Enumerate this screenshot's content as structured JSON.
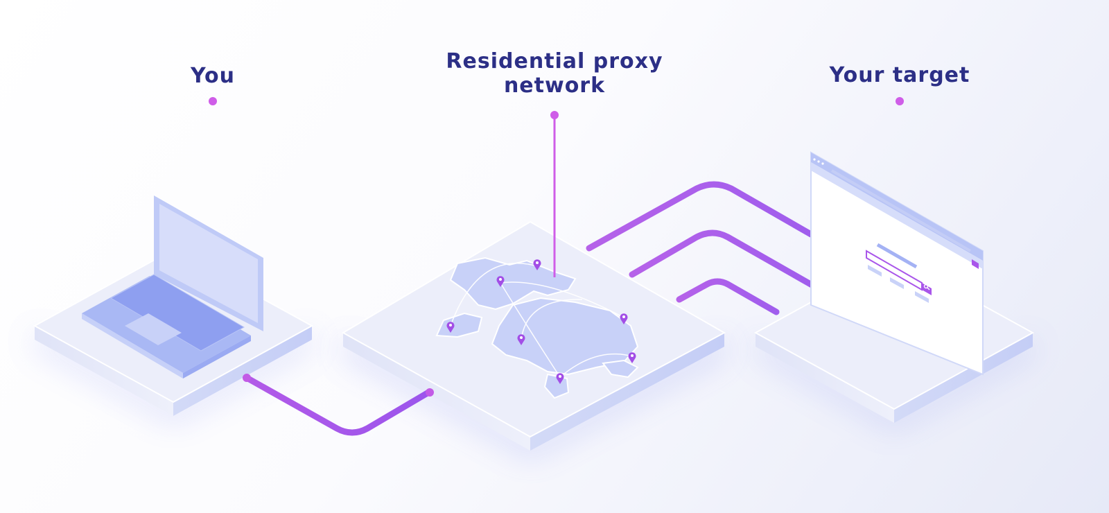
{
  "labels": {
    "you": "You",
    "network_line1": "Residential proxy",
    "network_line2": "network",
    "target": "Your target"
  },
  "colors": {
    "label_text": "#2c2f86",
    "connector": "#a956ea",
    "accent_pin": "#cf5de8",
    "platform": "#e9ebf8",
    "device_blue": "#b8c4f6",
    "keys": "#93a4f2"
  },
  "icons": [
    "laptop-icon",
    "world-map-icon",
    "location-pin-icon",
    "browser-window-icon",
    "search-icon"
  ]
}
